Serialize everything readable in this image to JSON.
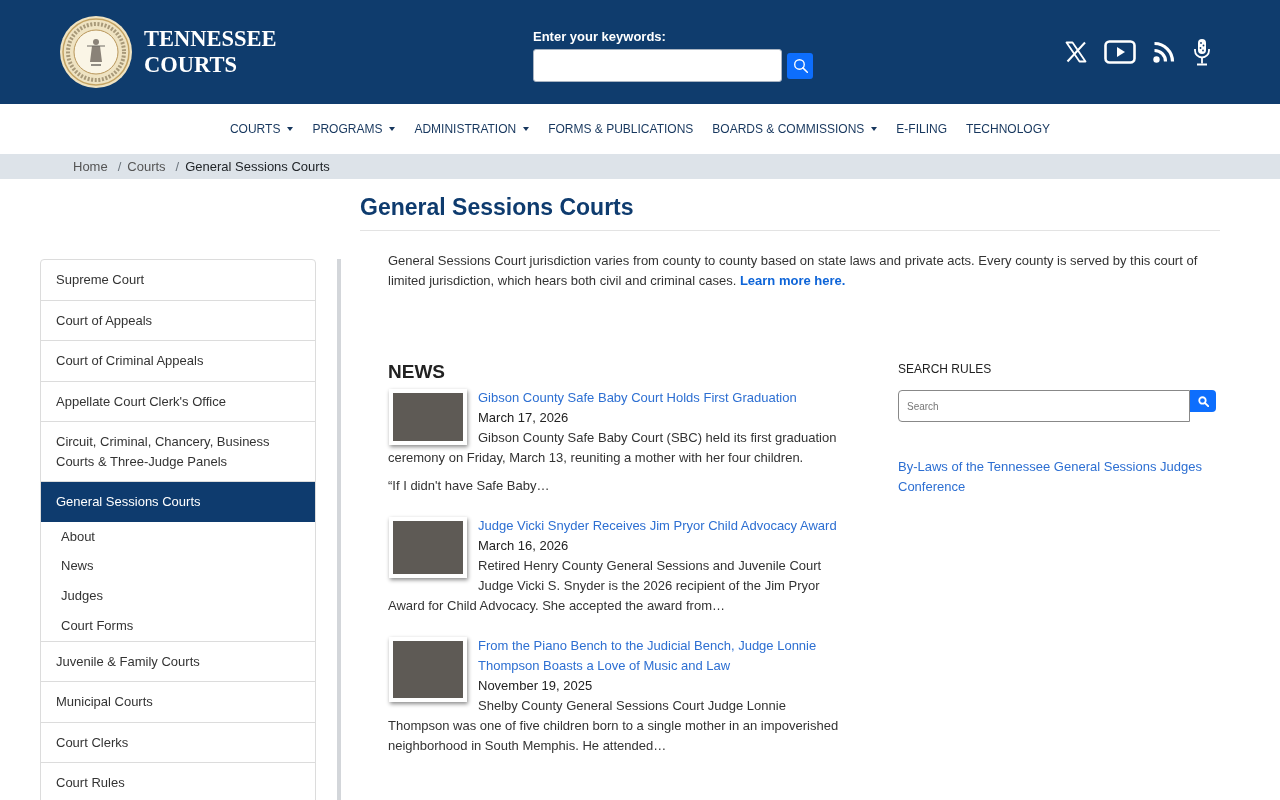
{
  "header": {
    "title_lines": [
      "TENNESSEE",
      "COURTS"
    ],
    "search": {
      "label": "Enter your keywords:"
    }
  },
  "nav": [
    {
      "label": "COURTS",
      "has_menu": true
    },
    {
      "label": "PROGRAMS",
      "has_menu": true
    },
    {
      "label": "ADMINISTRATION",
      "has_menu": true
    },
    {
      "label": "FORMS & PUBLICATIONS",
      "has_menu": false
    },
    {
      "label": "BOARDS & COMMISSIONS",
      "has_menu": true
    },
    {
      "label": "E-FILING",
      "has_menu": false
    },
    {
      "label": "TECHNOLOGY",
      "has_menu": false
    }
  ],
  "breadcrumb": [
    {
      "label": "Home",
      "kind": "link"
    },
    {
      "separator": "/",
      "label": "Courts",
      "kind": "link"
    },
    {
      "separator": "/",
      "label": "General Sessions Courts",
      "kind": "current"
    }
  ],
  "page_title": "General Sessions Courts",
  "intro": {
    "text": "General Sessions Court jurisdiction varies from county to county based on state laws and private acts. Every county is served by this court of limited jurisdiction, which hears both civil and criminal cases.",
    "link": "Learn more here."
  },
  "sidebar": {
    "items": [
      {
        "label": "Supreme Court",
        "selected": false
      },
      {
        "label": "Court of Appeals",
        "selected": false
      },
      {
        "label": "Court of Criminal Appeals",
        "selected": false
      },
      {
        "label": "Appellate Court Clerk's Office",
        "selected": false
      },
      {
        "label": "Circuit, Criminal, Chancery, Business Courts & Three-Judge Panels",
        "selected": false
      },
      {
        "label": "General Sessions Courts",
        "selected": true,
        "children": [
          {
            "label": "About",
            "selected": false
          },
          {
            "label": "News",
            "selected": false
          },
          {
            "label": "Judges",
            "selected": false
          },
          {
            "label": "Court Forms",
            "selected": false
          }
        ]
      },
      {
        "label": "Juvenile & Family Courts",
        "selected": false
      },
      {
        "label": "Municipal Courts",
        "selected": false
      },
      {
        "label": "Court Clerks",
        "selected": false
      },
      {
        "label": "Court Rules",
        "selected": false
      }
    ]
  },
  "news": {
    "heading": "NEWS",
    "items": [
      {
        "title": "Gibson County Safe Baby Court Holds First Graduation",
        "date": "March 17, 2026",
        "summary": "Gibson County Safe Baby Court (SBC) held its first graduation ceremony on Friday, March 13, reuniting a mother with her four children.",
        "paragraphs": [
          "“If I didn't have Safe Baby…"
        ]
      },
      {
        "title": "Judge Vicki Snyder Receives Jim Pryor Child Advocacy Award",
        "date": "March 16, 2026",
        "summary": "Retired Henry County General Sessions and Juvenile Court Judge Vicki S. Snyder is the 2026 recipient of the Jim Pryor Award for Child Advocacy. She accepted the award from…"
      },
      {
        "title": "From the Piano Bench to the Judicial Bench, Judge Lonnie Thompson Boasts a Love of Music and Law",
        "date": "November 19, 2025",
        "summary": "Shelby County General Sessions Court Judge Lonnie Thompson was one of five children born to a single mother in an impoverished neighborhood in South Memphis. He attended…"
      }
    ]
  },
  "rules_search": {
    "heading": "SEARCH RULES",
    "placeholder": "Search"
  },
  "links": [
    "By-Laws of the Tennessee General Sessions Judges Conference"
  ]
}
